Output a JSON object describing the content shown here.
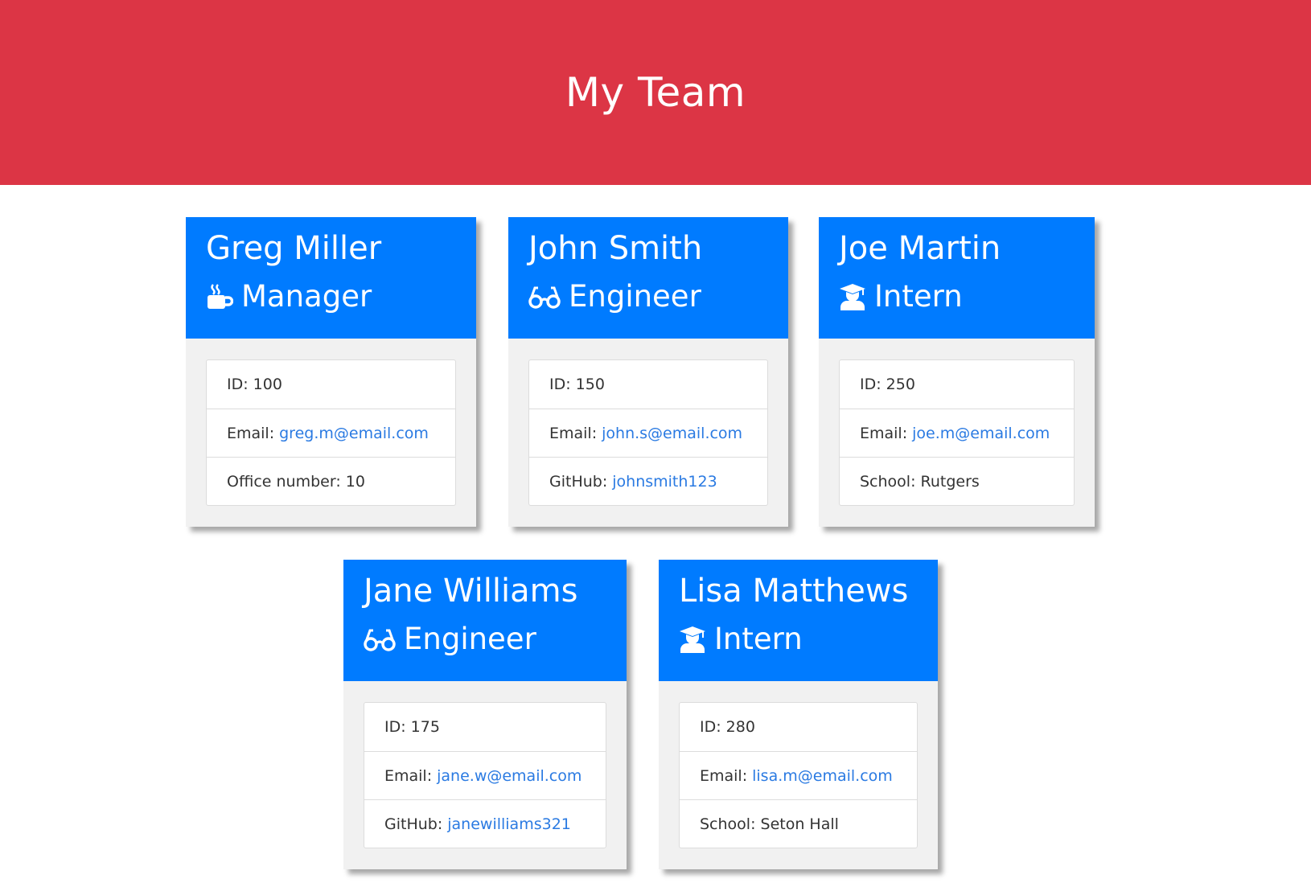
{
  "page_title": "My Team",
  "colors": {
    "header": "#dc3545",
    "card_head": "#007bff",
    "link": "#2a7ae2"
  },
  "cards": [
    {
      "name": "Greg Miller",
      "role": "Manager",
      "icon": "coffee-mug-icon",
      "id_label": "ID: 100",
      "email_label": "Email:",
      "email": "greg.m@email.com",
      "extra_label": "Office number: 10",
      "extra_link": ""
    },
    {
      "name": "John Smith",
      "role": "Engineer",
      "icon": "glasses-icon",
      "id_label": "ID: 150",
      "email_label": "Email:",
      "email": "john.s@email.com",
      "extra_label": "GitHub:",
      "extra_link": "johnsmith123"
    },
    {
      "name": "Joe Martin",
      "role": "Intern",
      "icon": "graduate-icon",
      "id_label": "ID: 250",
      "email_label": "Email:",
      "email": "joe.m@email.com",
      "extra_label": "School: Rutgers",
      "extra_link": ""
    },
    {
      "name": "Jane Williams",
      "role": "Engineer",
      "icon": "glasses-icon",
      "id_label": "ID: 175",
      "email_label": "Email:",
      "email": "jane.w@email.com",
      "extra_label": "GitHub:",
      "extra_link": "janewilliams321"
    },
    {
      "name": "Lisa Matthews",
      "role": "Intern",
      "icon": "graduate-icon",
      "id_label": "ID: 280",
      "email_label": "Email:",
      "email": "lisa.m@email.com",
      "extra_label": "School: Seton Hall",
      "extra_link": ""
    }
  ]
}
